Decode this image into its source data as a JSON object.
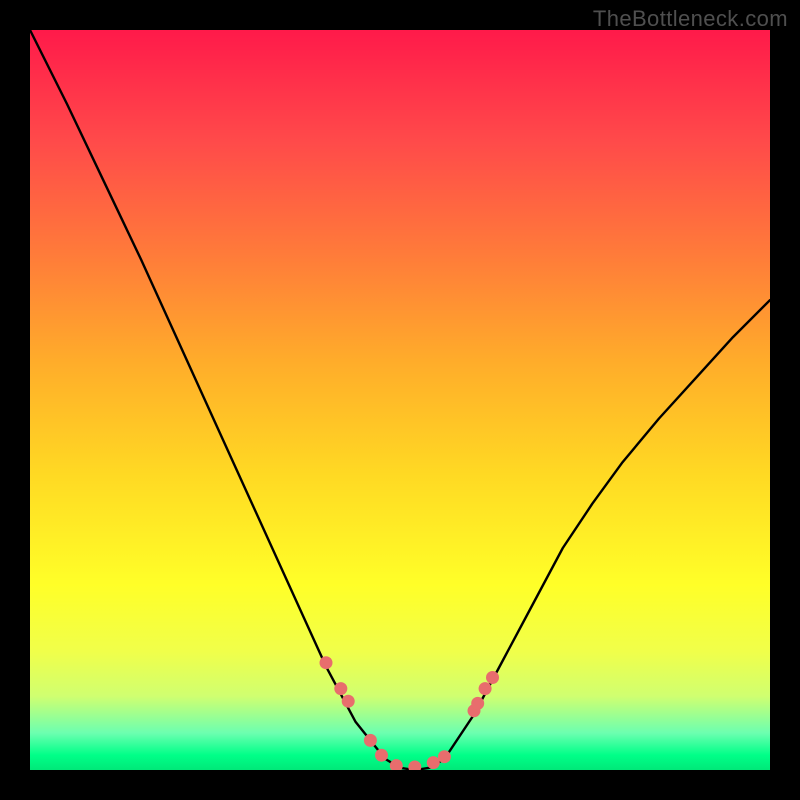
{
  "watermark": "TheBottleneck.com",
  "chart_data": {
    "type": "line",
    "title": "",
    "xlabel": "",
    "ylabel": "",
    "xlim": [
      0,
      1
    ],
    "ylim": [
      0,
      1
    ],
    "series": [
      {
        "name": "bottleneck-curve",
        "x": [
          0.0,
          0.05,
          0.1,
          0.15,
          0.2,
          0.25,
          0.3,
          0.35,
          0.4,
          0.44,
          0.48,
          0.5,
          0.52,
          0.54,
          0.56,
          0.6,
          0.64,
          0.68,
          0.72,
          0.76,
          0.8,
          0.85,
          0.9,
          0.95,
          1.0
        ],
        "y": [
          1.0,
          0.9,
          0.795,
          0.69,
          0.58,
          0.47,
          0.36,
          0.25,
          0.14,
          0.065,
          0.015,
          0.003,
          0.0,
          0.003,
          0.015,
          0.075,
          0.15,
          0.225,
          0.3,
          0.36,
          0.415,
          0.475,
          0.53,
          0.585,
          0.635
        ]
      }
    ],
    "marker_points": {
      "name": "highlight-dots",
      "x": [
        0.4,
        0.42,
        0.43,
        0.46,
        0.475,
        0.495,
        0.52,
        0.545,
        0.56,
        0.6,
        0.605,
        0.615,
        0.625
      ],
      "y": [
        0.145,
        0.11,
        0.093,
        0.04,
        0.02,
        0.006,
        0.004,
        0.01,
        0.018,
        0.08,
        0.09,
        0.11,
        0.125
      ]
    },
    "colors": {
      "curve": "#000000",
      "markers": "#e86d6d",
      "gradient_top": "#ff1a4a",
      "gradient_bottom": "#00e879"
    }
  }
}
